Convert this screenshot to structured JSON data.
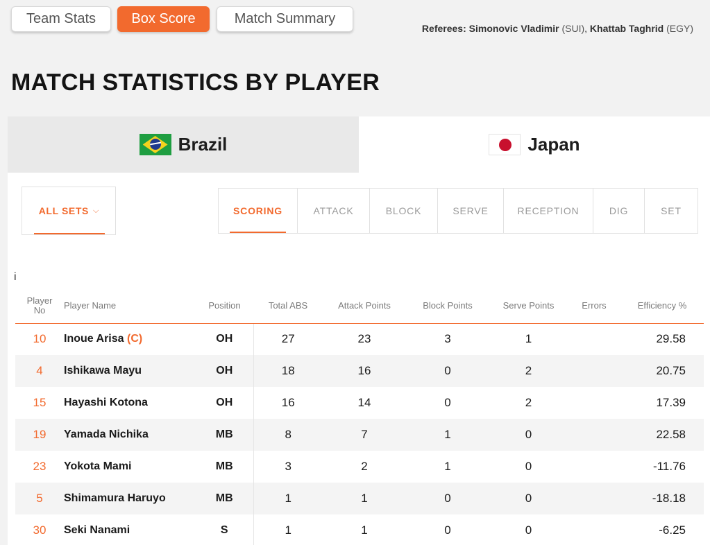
{
  "nav": {
    "tabs": [
      {
        "label": "Team Stats"
      },
      {
        "label": "Box Score"
      },
      {
        "label": "Match Summary"
      }
    ]
  },
  "referees": {
    "label": "Referees:",
    "list": [
      {
        "name": "Simonovic Vladimir",
        "country": "(SUI)"
      },
      {
        "name": "Khattab Taghrid",
        "country": "(EGY)"
      }
    ]
  },
  "page_title": "MATCH STATISTICS BY PLAYER",
  "teams": [
    {
      "name": "Brazil",
      "flag": "brazil-flag-icon"
    },
    {
      "name": "Japan",
      "flag": "japan-flag-icon"
    }
  ],
  "sets_filter": {
    "label": "ALL SETS"
  },
  "stat_tabs": [
    "SCORING",
    "ATTACK",
    "BLOCK",
    "SERVE",
    "RECEPTION",
    "DIG",
    "SET"
  ],
  "info_glyph": "i",
  "table": {
    "headers": {
      "player_no_1": "Player",
      "player_no_2": "No",
      "player_name": "Player Name",
      "position": "Position",
      "total_abs": "Total ABS",
      "attack_points": "Attack Points",
      "block_points": "Block Points",
      "serve_points": "Serve Points",
      "errors": "Errors",
      "efficiency": "Efficiency %"
    },
    "rows": [
      {
        "no": "10",
        "name": "Inoue Arisa",
        "captain": "(C)",
        "pos": "OH",
        "total": "27",
        "attack": "23",
        "block": "3",
        "serve": "1",
        "errors": "",
        "eff": "29.58"
      },
      {
        "no": "4",
        "name": "Ishikawa Mayu",
        "captain": "",
        "pos": "OH",
        "total": "18",
        "attack": "16",
        "block": "0",
        "serve": "2",
        "errors": "",
        "eff": "20.75"
      },
      {
        "no": "15",
        "name": "Hayashi Kotona",
        "captain": "",
        "pos": "OH",
        "total": "16",
        "attack": "14",
        "block": "0",
        "serve": "2",
        "errors": "",
        "eff": "17.39"
      },
      {
        "no": "19",
        "name": "Yamada Nichika",
        "captain": "",
        "pos": "MB",
        "total": "8",
        "attack": "7",
        "block": "1",
        "serve": "0",
        "errors": "",
        "eff": "22.58"
      },
      {
        "no": "23",
        "name": "Yokota Mami",
        "captain": "",
        "pos": "MB",
        "total": "3",
        "attack": "2",
        "block": "1",
        "serve": "0",
        "errors": "",
        "eff": "-11.76"
      },
      {
        "no": "5",
        "name": "Shimamura Haruyo",
        "captain": "",
        "pos": "MB",
        "total": "1",
        "attack": "1",
        "block": "0",
        "serve": "0",
        "errors": "",
        "eff": "-18.18"
      },
      {
        "no": "30",
        "name": "Seki Nanami",
        "captain": "",
        "pos": "S",
        "total": "1",
        "attack": "1",
        "block": "0",
        "serve": "0",
        "errors": "",
        "eff": "-6.25"
      }
    ]
  },
  "colors": {
    "accent": "#f26a2e",
    "background": "#f2f2f2"
  }
}
